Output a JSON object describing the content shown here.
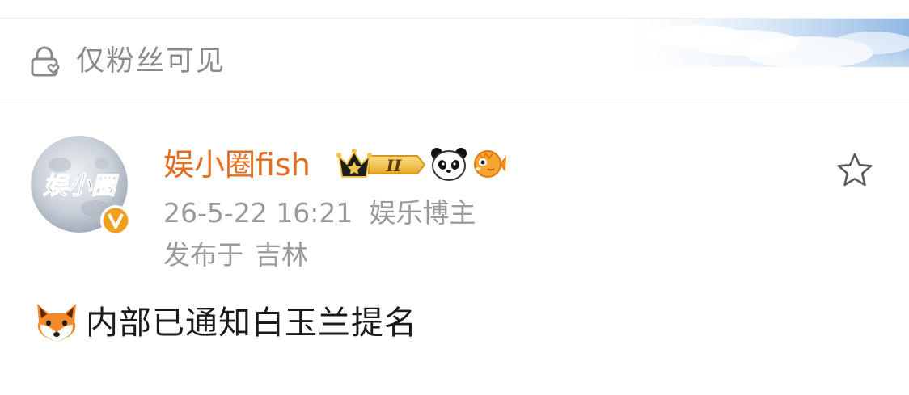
{
  "visibility": {
    "icon": "lock-heart-icon",
    "label": "仅粉丝可见"
  },
  "author": {
    "avatar_text": "娱小圈",
    "name": "娱小圈fish",
    "badges": [
      "crown-level-icon",
      "panda-icon",
      "fish-icon"
    ],
    "badge_level": "II",
    "verified_mark": "V"
  },
  "meta": {
    "timestamp": "26-5-22 16:21",
    "role": "娱乐博主",
    "location_prefix": "发布于",
    "location": "吉林"
  },
  "post": {
    "emoji": "fox-icon",
    "text": "内部已通知白玉兰提名"
  },
  "actions": {
    "favorite_icon": "star-icon"
  },
  "colors": {
    "username": "#e46d21",
    "meta_text": "#9a9a9a",
    "body_text": "#1a1a1a",
    "verified_badge": "#f0a020",
    "crown_gold": "#f3c54a"
  }
}
